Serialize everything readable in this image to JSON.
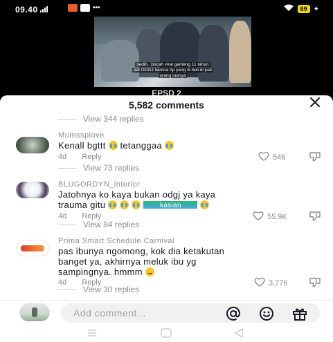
{
  "status_bar": {
    "time": "09.40",
    "battery": "69"
  },
  "video": {
    "caption_line1": "sedih.. bocah viral ganteng 11 tahun",
    "caption_line2": "adi ODGJ karena hp yang di beli di jual",
    "caption_line3": "orang tuanya",
    "label": "EPSD 2"
  },
  "comments_header": {
    "count_label": "5,582 comments"
  },
  "replies_top": "View 344 replies",
  "comments": [
    {
      "username": "Mumssplove",
      "text_main": "Kenall bgttt",
      "text_tail": " tetanggaa",
      "age": "4d",
      "reply_label": "Reply",
      "likes": "546",
      "view_replies": "View 73 replies"
    },
    {
      "username": "BLUGORDYN_interior",
      "text_line1": "Jatohnya ko kaya bukan odgj ya kaya",
      "text_line2": "trauma gitu",
      "strike_text": "kasian",
      "age": "4d",
      "reply_label": "Reply",
      "likes": "55.9K",
      "view_replies": "View 84 replies"
    },
    {
      "username": "Prima Smart Schedule Carnival",
      "text_line1": "pas ibunya ngomong, kok dia ketakutan",
      "text_line2": "banget ya, akhirnya meluk ibu yg",
      "text_line3": "sampingnya. hmmm",
      "age": "4d",
      "reply_label": "Reply",
      "likes": "3,776",
      "view_replies": "View 30 replies"
    }
  ],
  "input": {
    "placeholder": "Add comment...",
    "value": ""
  },
  "colors": {
    "accent_text": "#161823",
    "muted_text": "#8a8b91",
    "emoji_yellow": "#f7c52a"
  },
  "icons": [
    "signal-icon",
    "close-icon",
    "heart-icon",
    "dislike-icon",
    "at-icon",
    "emoji-icon",
    "gift-icon",
    "menu-nav-icon",
    "home-nav-icon",
    "back-nav-icon"
  ]
}
